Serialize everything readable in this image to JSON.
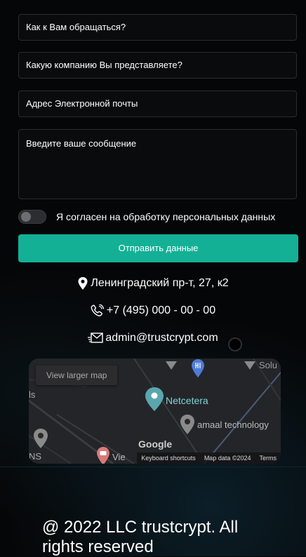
{
  "form": {
    "name_placeholder": "Как к Вам обращаться?",
    "company_placeholder": "Какую компанию Вы представляете?",
    "email_placeholder": "Адрес Электронной почты",
    "message_placeholder": "Введите ваше сообщение",
    "consent_label": "Я согласен на обработку персональных данных",
    "consent_checked": false,
    "submit_label": "Отправить данные",
    "accent_color": "#14b096"
  },
  "contacts": {
    "address": "Ленинградский пр-т, 27, к2",
    "phone": "+7 (495) 000 - 00 - 00",
    "email": "admin@trustcrypt.com"
  },
  "map": {
    "view_larger": "View larger map",
    "poi_netcetera": "Netcetera",
    "poi_amaal": "amaal technology",
    "poi_solu": "Solu",
    "poi_vie": "Vie",
    "label_ls": "ls",
    "label_ns": "NS",
    "logo": "Google",
    "keyboard": "Keyboard shortcuts",
    "map_data": "Map data ©2024",
    "terms": "Terms"
  },
  "footer": {
    "copyright": "@ 2022 LLC trustcrypt. All rights reserved"
  }
}
